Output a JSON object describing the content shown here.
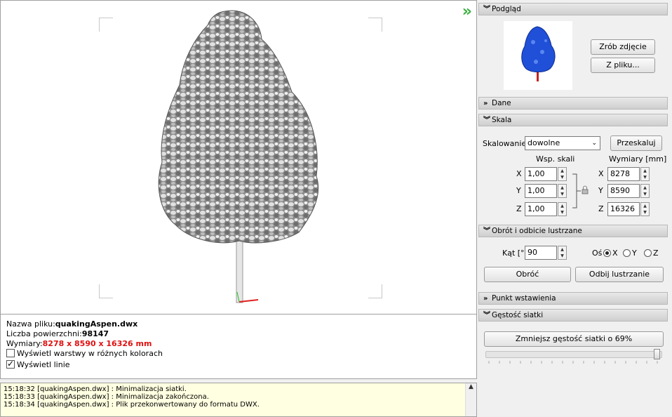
{
  "viewport": {
    "expand_icon": "double-chevron-right-icon"
  },
  "info": {
    "filename_label": "Nazwa pliku:",
    "filename": "quakingAspen.dwx",
    "surfaces_label": "Liczba powierzchni:",
    "surfaces": "98147",
    "dims_label": "Wymiary:",
    "dims": "8278 x 8590 x 16326 mm",
    "layers_checkbox": "Wyświetl warstwy w różnych kolorach",
    "lines_checkbox": "Wyświetl linie"
  },
  "log": {
    "lines": [
      "15:18:32 [quakingAspen.dwx] : Minimalizacja siatki.",
      "15:18:33 [quakingAspen.dwx] : Minimalizacja zakończona.",
      "15:18:34 [quakingAspen.dwx] : Plik przekonwertowany do formatu DWX."
    ]
  },
  "panel": {
    "preview": {
      "title": "Podgląd",
      "photo_btn": "Zrób zdjęcie",
      "file_btn": "Z pliku..."
    },
    "data": {
      "title": "Dane"
    },
    "scale": {
      "title": "Skala",
      "mode_label": "Skalowanie",
      "mode_value": "dowolne",
      "rescale_btn": "Przeskaluj",
      "factor_header": "Wsp. skali",
      "dims_header": "Wymiary [mm]",
      "x_label": "X",
      "y_label": "Y",
      "z_label": "Z",
      "x_factor": "1,00",
      "y_factor": "1,00",
      "z_factor": "1,00",
      "x_dim": "8278",
      "y_dim": "8590",
      "z_dim": "16326"
    },
    "rotation": {
      "title": "Obrót i odbicie lustrzane",
      "angle_label": "Kąt [°]",
      "angle_value": "90",
      "axis_label": "Oś",
      "axis_x": "X",
      "axis_y": "Y",
      "axis_z": "Z",
      "rotate_btn": "Obróć",
      "mirror_btn": "Odbij lustrzanie"
    },
    "insert_point": {
      "title": "Punkt wstawienia"
    },
    "mesh": {
      "title": "Gęstość siatki",
      "reduce_btn": "Zmniejsz gęstość siatki o 69%"
    }
  }
}
